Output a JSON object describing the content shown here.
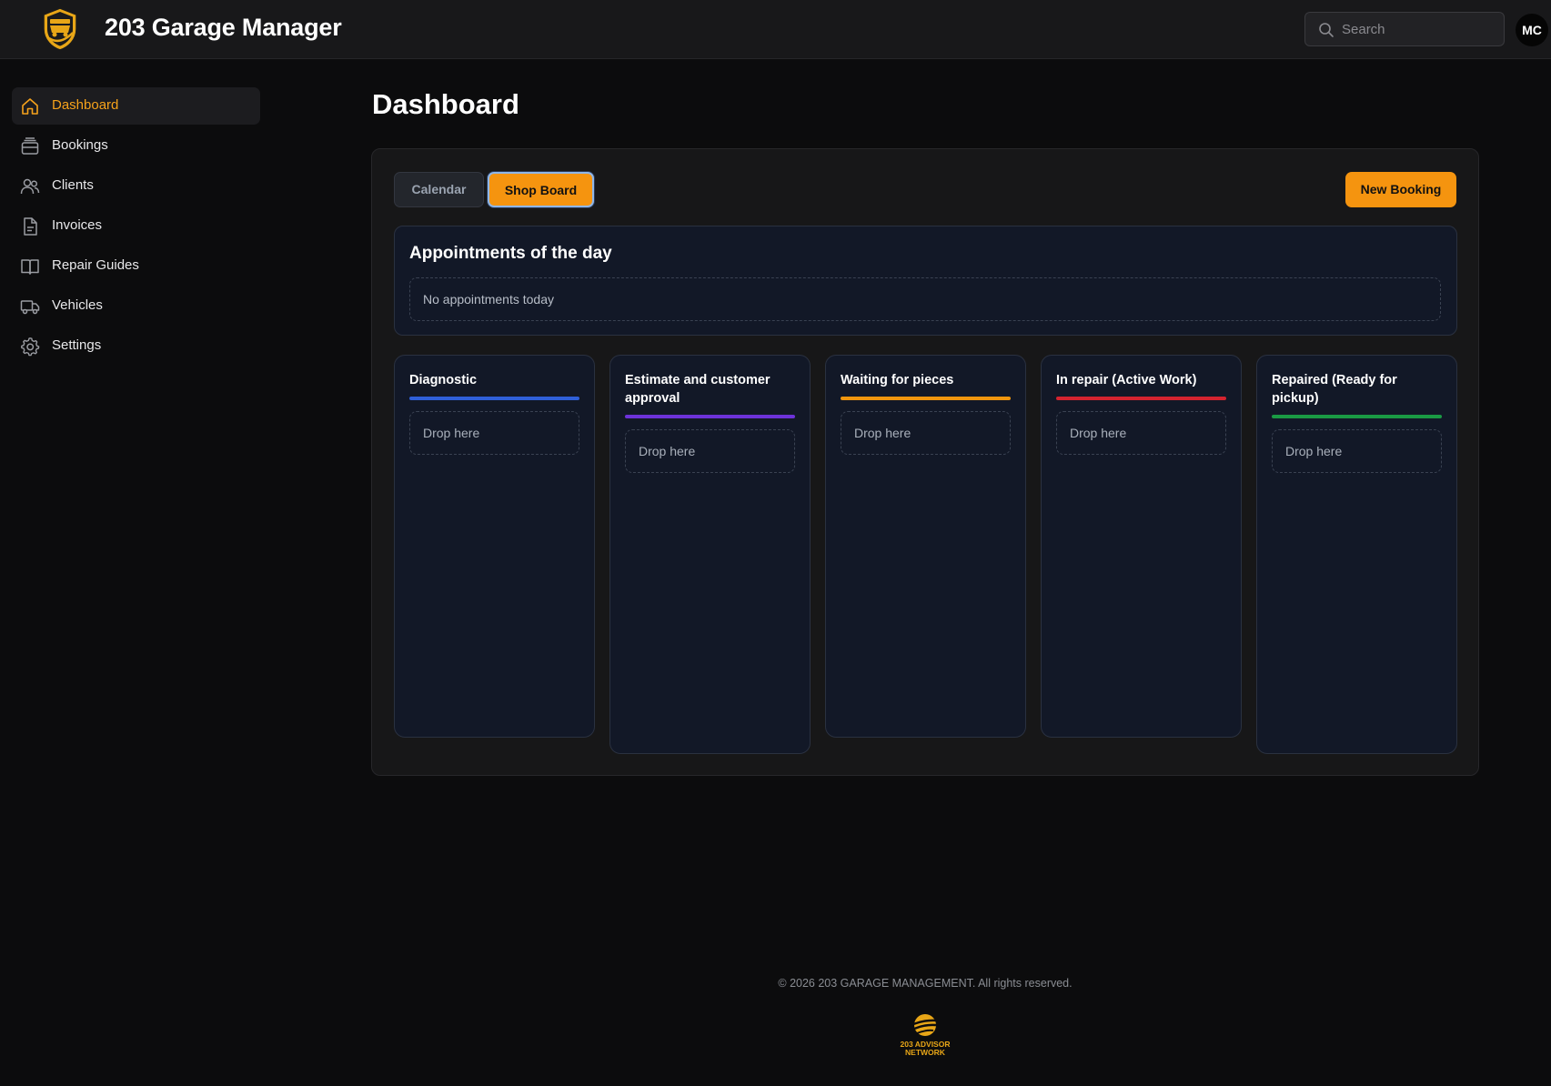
{
  "app": {
    "title": "203 Garage Manager"
  },
  "header": {
    "search_placeholder": "Search",
    "avatar_initials": "MC"
  },
  "sidebar": {
    "items": [
      {
        "label": "Dashboard",
        "icon": "home-icon",
        "active": true
      },
      {
        "label": "Bookings",
        "icon": "bookings-icon",
        "active": false
      },
      {
        "label": "Clients",
        "icon": "users-icon",
        "active": false
      },
      {
        "label": "Invoices",
        "icon": "document-icon",
        "active": false
      },
      {
        "label": "Repair Guides",
        "icon": "book-icon",
        "active": false
      },
      {
        "label": "Vehicles",
        "icon": "truck-icon",
        "active": false
      },
      {
        "label": "Settings",
        "icon": "gear-icon",
        "active": false
      }
    ]
  },
  "main": {
    "title": "Dashboard",
    "tabs": [
      {
        "label": "Calendar",
        "active": false
      },
      {
        "label": "Shop Board",
        "active": true
      }
    ],
    "new_booking_label": "New Booking",
    "appointments": {
      "title": "Appointments of the day",
      "empty_text": "No appointments today"
    },
    "columns": [
      {
        "title": "Diagnostic",
        "color": "#2f5fd8",
        "drop_text": "Drop here"
      },
      {
        "title": "Estimate and customer approval",
        "color": "#6d32d9",
        "drop_text": "Drop here"
      },
      {
        "title": "Waiting for pieces",
        "color": "#f0960e",
        "drop_text": "Drop here"
      },
      {
        "title": "In repair (Active Work)",
        "color": "#d4232f",
        "drop_text": "Drop here"
      },
      {
        "title": "Repaired (Ready for pickup)",
        "color": "#1a9a44",
        "drop_text": "Drop here"
      }
    ]
  },
  "footer": {
    "copyright": "© 2026 203 GARAGE MANAGEMENT. All rights reserved.",
    "logo_text": "203 ADVISOR NETWORK"
  },
  "colors": {
    "accent": "#f5940f",
    "active_nav_text": "#f5a21b"
  }
}
